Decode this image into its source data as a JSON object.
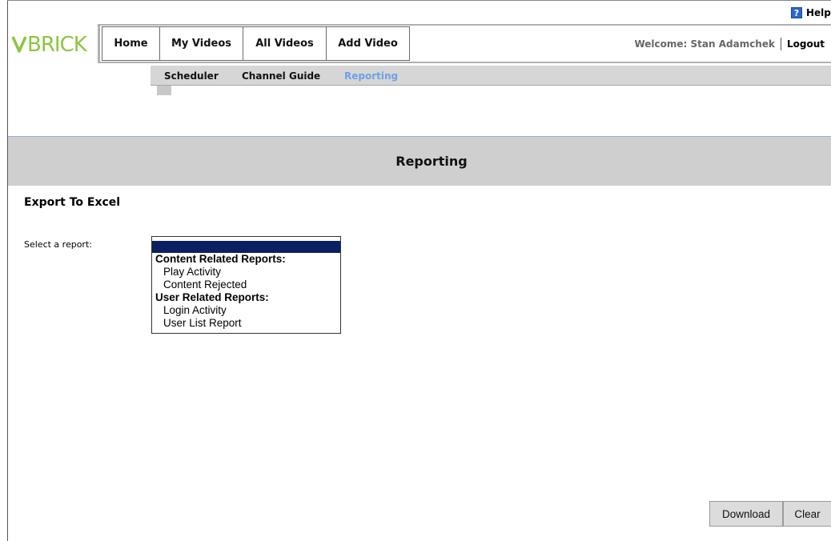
{
  "header": {
    "help_label": "Help",
    "help_icon_glyph": "?",
    "logo_text": "VBRICK",
    "welcome_text": "Welcome: Stan Adamchek",
    "logout_label": "Logout"
  },
  "nav": {
    "tabs": [
      {
        "label": "Home"
      },
      {
        "label": "My Videos"
      },
      {
        "label": "All Videos"
      },
      {
        "label": "Add Video"
      }
    ]
  },
  "subnav": {
    "items": [
      {
        "label": "Scheduler"
      },
      {
        "label": "Channel Guide"
      },
      {
        "label": "Reporting",
        "active": true
      }
    ],
    "active_color": "#6fa0e8"
  },
  "page": {
    "title": "Reporting",
    "section_heading": "Export To Excel",
    "select_label": "Select a report:"
  },
  "report_list": {
    "selected": "",
    "groups": [
      {
        "label": "Content Related Reports:",
        "options": [
          "Play Activity",
          "Content Rejected"
        ]
      },
      {
        "label": "User Related Reports:",
        "options": [
          "Login Activity",
          "User List Report"
        ]
      }
    ]
  },
  "actions": {
    "download_label": "Download",
    "clear_label": "Clear"
  },
  "colors": {
    "logo_green": "#8dc63f",
    "selection_navy": "#0b2060",
    "band_gray": "#cfcfcf"
  }
}
